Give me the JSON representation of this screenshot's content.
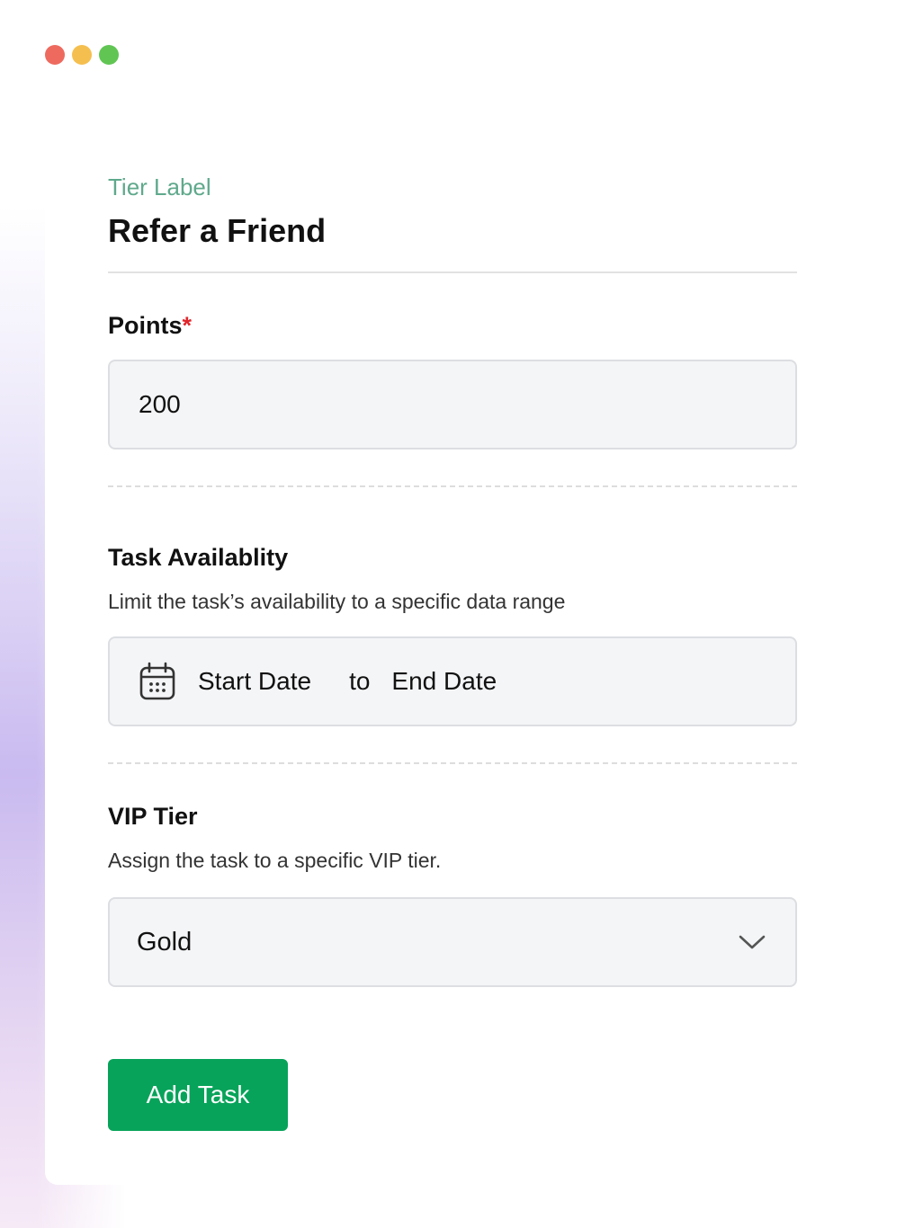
{
  "window": {
    "controls": [
      "close",
      "minimize",
      "maximize"
    ]
  },
  "header": {
    "tier_label": "Tier Label",
    "title": "Refer a Friend"
  },
  "points": {
    "label": "Points",
    "required_mark": "*",
    "value": "200"
  },
  "availability": {
    "label": "Task Availablity",
    "description": "Limit the task’s availability to a specific data range",
    "icon": "calendar-icon",
    "start_placeholder": "Start Date",
    "separator": "to",
    "end_placeholder": "End Date"
  },
  "vip": {
    "label": "VIP Tier",
    "description": "Assign the task to a specific VIP tier.",
    "selected": "Gold",
    "icon": "chevron-down-icon"
  },
  "actions": {
    "add_task": "Add Task"
  },
  "colors": {
    "accent_green": "#07a35a",
    "tier_label_green": "#5fa98c",
    "required_red": "#e0262b",
    "field_bg": "#f4f5f7"
  }
}
